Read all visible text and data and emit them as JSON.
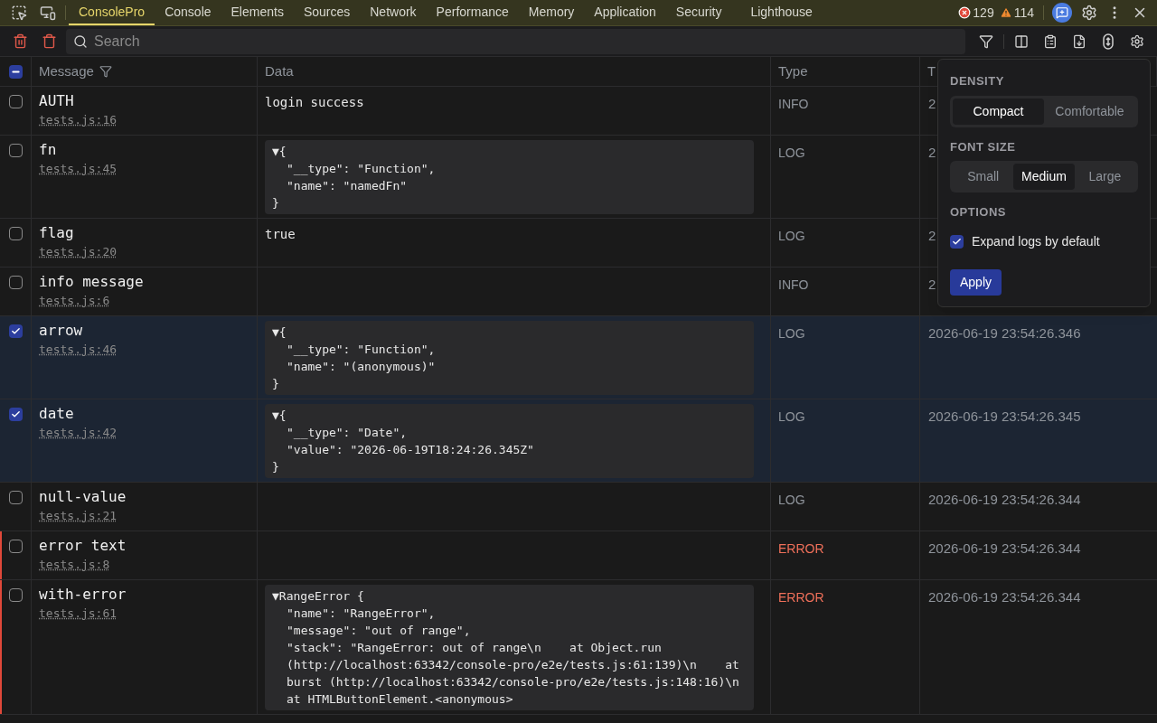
{
  "tabs": [
    {
      "label": "ConsolePro",
      "selected": true
    },
    {
      "label": "Console",
      "selected": false
    },
    {
      "label": "Elements",
      "selected": false
    },
    {
      "label": "Sources",
      "selected": false
    },
    {
      "label": "Network",
      "selected": false
    },
    {
      "label": "Performance",
      "selected": false
    },
    {
      "label": "Memory",
      "selected": false
    },
    {
      "label": "Application",
      "selected": false
    },
    {
      "label": "Security",
      "selected": false
    },
    {
      "label": "Lighthouse",
      "selected": false
    }
  ],
  "counters": {
    "errors": "129",
    "warnings": "114"
  },
  "search": {
    "placeholder": "Search"
  },
  "table": {
    "select_all": {
      "indeterminate": true
    },
    "columns": [
      "Message",
      "Data",
      "Type",
      "T"
    ],
    "rows": [
      {
        "message": "AUTH",
        "source": "tests.js:16",
        "data": {
          "kind": "text",
          "text": "login success"
        },
        "type": "INFO",
        "color": "#8f949b",
        "time": "2",
        "checked": false
      },
      {
        "message": "fn",
        "source": "tests.js:45",
        "data": {
          "kind": "object",
          "head": "▼{",
          "lines": [
            "\"__type\": \"Function\",",
            "\"name\": \"namedFn\""
          ],
          "tail": "}"
        },
        "type": "LOG",
        "color": "#8f949b",
        "time": "2",
        "checked": false
      },
      {
        "message": "flag",
        "source": "tests.js:20",
        "data": {
          "kind": "text",
          "text": "true"
        },
        "type": "LOG",
        "color": "#8f949b",
        "time": "2",
        "checked": false
      },
      {
        "message": "info message",
        "source": "tests.js:6",
        "type": "INFO",
        "color": "#8f949b",
        "time": "2",
        "checked": false
      },
      {
        "message": "arrow",
        "source": "tests.js:46",
        "data": {
          "kind": "object",
          "head": "▼{",
          "lines": [
            "\"__type\": \"Function\",",
            "\"name\": \"(anonymous)\""
          ],
          "tail": "}"
        },
        "type": "LOG",
        "color": "#8f949b",
        "time": "2026-06-19 23:54:26.346",
        "checked": true
      },
      {
        "message": "date",
        "source": "tests.js:42",
        "data": {
          "kind": "object",
          "head": "▼{",
          "lines": [
            "\"__type\": \"Date\",",
            "\"value\": \"2026-06-19T18:24:26.345Z\""
          ],
          "tail": "}"
        },
        "type": "LOG",
        "color": "#8f949b",
        "time": "2026-06-19 23:54:26.345",
        "checked": true
      },
      {
        "message": "null-value",
        "source": "tests.js:21",
        "type": "LOG",
        "color": "#8f949b",
        "time": "2026-06-19 23:54:26.344",
        "checked": false
      },
      {
        "message": "error text",
        "source": "tests.js:8",
        "type": "ERROR",
        "color": "#f0705a",
        "time": "2026-06-19 23:54:26.344",
        "checked": false
      },
      {
        "message": "with-error",
        "source": "tests.js:61",
        "data": {
          "kind": "object",
          "head": "▼RangeError {",
          "lines": [
            "\"name\": \"RangeError\",",
            "\"message\": \"out of range\",",
            "\"stack\": \"RangeError: out of range\\n    at Object.run",
            "(http://localhost:63342/console-pro/e2e/tests.js:61:139)\\n    at",
            "burst (http://localhost:63342/console-pro/e2e/tests.js:148:16)\\n",
            "at HTMLButtonElement.<anonymous>"
          ]
        },
        "type": "ERROR",
        "color": "#f0705a",
        "time": "2026-06-19 23:54:26.344",
        "checked": false
      }
    ]
  },
  "settings_popover": {
    "density": {
      "title": "DENSITY",
      "options": [
        {
          "label": "Compact",
          "selected": true
        },
        {
          "label": "Comfortable",
          "selected": false
        }
      ]
    },
    "font_size": {
      "title": "FONT SIZE",
      "options": [
        {
          "label": "Small",
          "selected": false
        },
        {
          "label": "Medium",
          "selected": true
        },
        {
          "label": "Large",
          "selected": false
        }
      ]
    },
    "options": {
      "title": "OPTIONS",
      "items": [
        {
          "label": "Expand logs by default",
          "checked": true
        }
      ]
    },
    "apply": "Apply"
  }
}
